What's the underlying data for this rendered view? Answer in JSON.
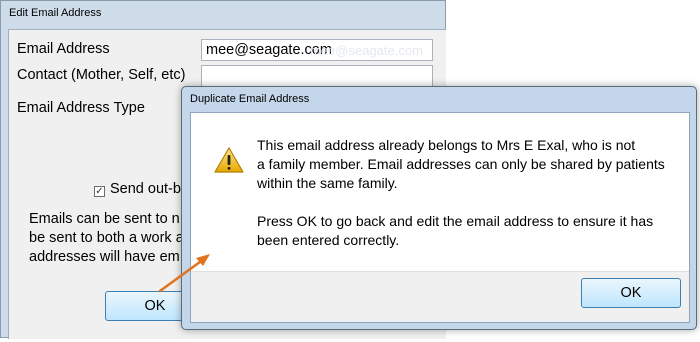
{
  "edit_window": {
    "title": "Edit Email Address",
    "email_label": "Email Address",
    "email_value": "mee@seagate.com",
    "email_ghost": "mee@seagate.com",
    "contact_label": "Contact (Mother, Self, etc)",
    "contact_value": "",
    "type_label": "Email Address Type",
    "send_checkbox_label": "Send out-be",
    "send_checked": true,
    "note_lines": [
      "Emails can be sent to n",
      "be sent to both a work a",
      "addresses will have em"
    ],
    "ok_label": "OK"
  },
  "dialog": {
    "title": "Duplicate Email Address",
    "icon": "warning-icon",
    "message_lines": [
      "This email address already belongs to Mrs E Exal, who is not",
      "a family member. Email addresses can only be shared by patients",
      "within the same family."
    ],
    "message2_lines": [
      "Press OK to go back and edit the email address to ensure it has",
      "been entered correctly."
    ],
    "ok_label": "OK"
  },
  "colors": {
    "arrow": "#e0731c",
    "warning_fill": "#f4c430"
  }
}
